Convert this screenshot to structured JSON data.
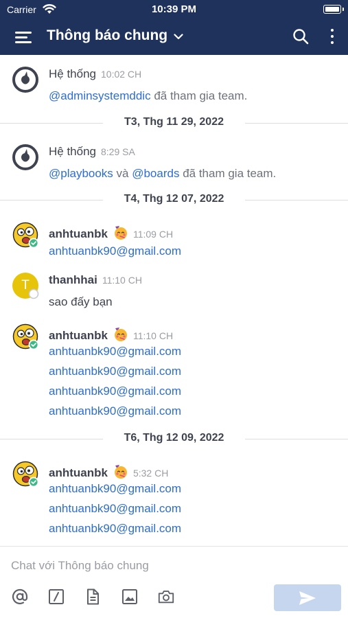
{
  "status_bar": {
    "carrier": "Carrier",
    "time": "10:39 PM"
  },
  "header": {
    "title": "Thông báo chung"
  },
  "feed": {
    "posts": [
      {
        "author": "Hệ thống",
        "time": "10:02 CH",
        "mention": "@adminsystemddic",
        "text": " đã tham gia team."
      },
      {
        "author": "Hệ thống",
        "time": "8:29 SA",
        "mention1": "@playbooks",
        "conj": " và ",
        "mention2": "@boards",
        "text": " đã tham gia team."
      },
      {
        "author": "anhtuanbk",
        "time": "11:09 CH",
        "lines": [
          "anhtuanbk90@gmail.com"
        ]
      },
      {
        "author": "thanhhai",
        "time": "11:10 CH",
        "avatar_letter": "T",
        "lines": [
          "sao đấy bạn"
        ]
      },
      {
        "author": "anhtuanbk",
        "time": "11:10 CH",
        "lines": [
          "anhtuanbk90@gmail.com",
          "anhtuanbk90@gmail.com",
          "anhtuanbk90@gmail.com",
          "anhtuanbk90@gmail.com"
        ]
      },
      {
        "author": "anhtuanbk",
        "time": "5:32 CH",
        "lines": [
          "anhtuanbk90@gmail.com",
          "anhtuanbk90@gmail.com",
          "anhtuanbk90@gmail.com"
        ]
      }
    ],
    "date_separators": [
      "T3, Thg 11 29, 2022",
      "T4, Thg 12 07, 2022",
      "T6, Thg 12 09, 2022"
    ]
  },
  "composer": {
    "placeholder": "Chat với Thông báo chung",
    "tools": [
      "at-sign-icon",
      "slash-command-icon",
      "file-icon",
      "image-icon",
      "camera-icon"
    ]
  },
  "colors": {
    "header_bg": "#1e325c",
    "link": "#2d6dd2",
    "send_disabled": "#c6d6ef",
    "online": "#3db887",
    "thanhhai_avatar": "#e6c40a"
  }
}
